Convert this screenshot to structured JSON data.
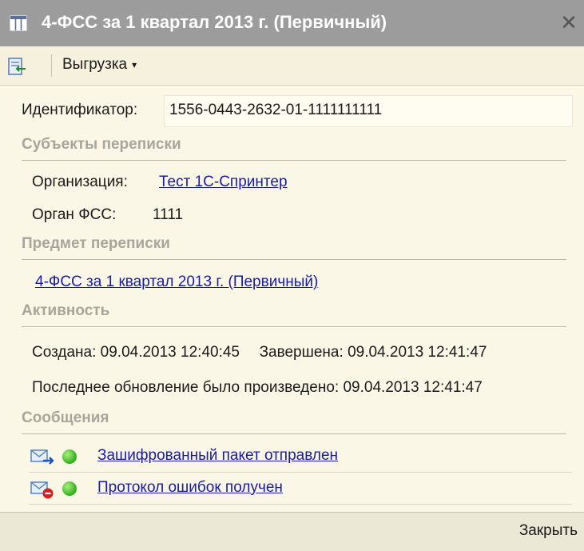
{
  "window": {
    "title": "4-ФСС за 1 квартал 2013 г. (Первичный)",
    "close_glyph": "✕"
  },
  "toolbar": {
    "export_label": "Выгрузка",
    "export_icon": "export-icon",
    "dropdown_glyph": "▾"
  },
  "identifier": {
    "label": "Идентификатор:",
    "value": "1556-0443-2632-01-1111111111"
  },
  "subjects": {
    "heading": "Субъекты переписки",
    "org_label": "Организация:",
    "org_value": "Тест 1С-Спринтер",
    "fss_label": "Орган ФСС:",
    "fss_value": "1111"
  },
  "subject_matter": {
    "heading": "Предмет переписки",
    "link": "4-ФСС за 1 квартал 2013 г. (Первичный)"
  },
  "activity": {
    "heading": "Активность",
    "created_label": "Создана:",
    "created_value": "09.04.2013 12:40:45",
    "finished_label": "Завершена:",
    "finished_value": "09.04.2013 12:41:47",
    "last_update_label": "Последнее обновление было произведено:",
    "last_update_value": "09.04.2013 12:41:47"
  },
  "messages": {
    "heading": "Сообщения",
    "items": [
      {
        "text": "Зашифрованный пакет отправлен",
        "icon": "envelope-sent-icon",
        "status_color": "#2fae1d"
      },
      {
        "text": "Протокол ошибок получен",
        "icon": "envelope-error-icon",
        "status_color": "#2fae1d"
      }
    ]
  },
  "footer": {
    "close_label": "Закрыть"
  },
  "colors": {
    "background": "#fbf7e6",
    "titlebar": "#9c9c9c",
    "link": "#1a1aaa",
    "section_heading": "#a8a69c"
  }
}
